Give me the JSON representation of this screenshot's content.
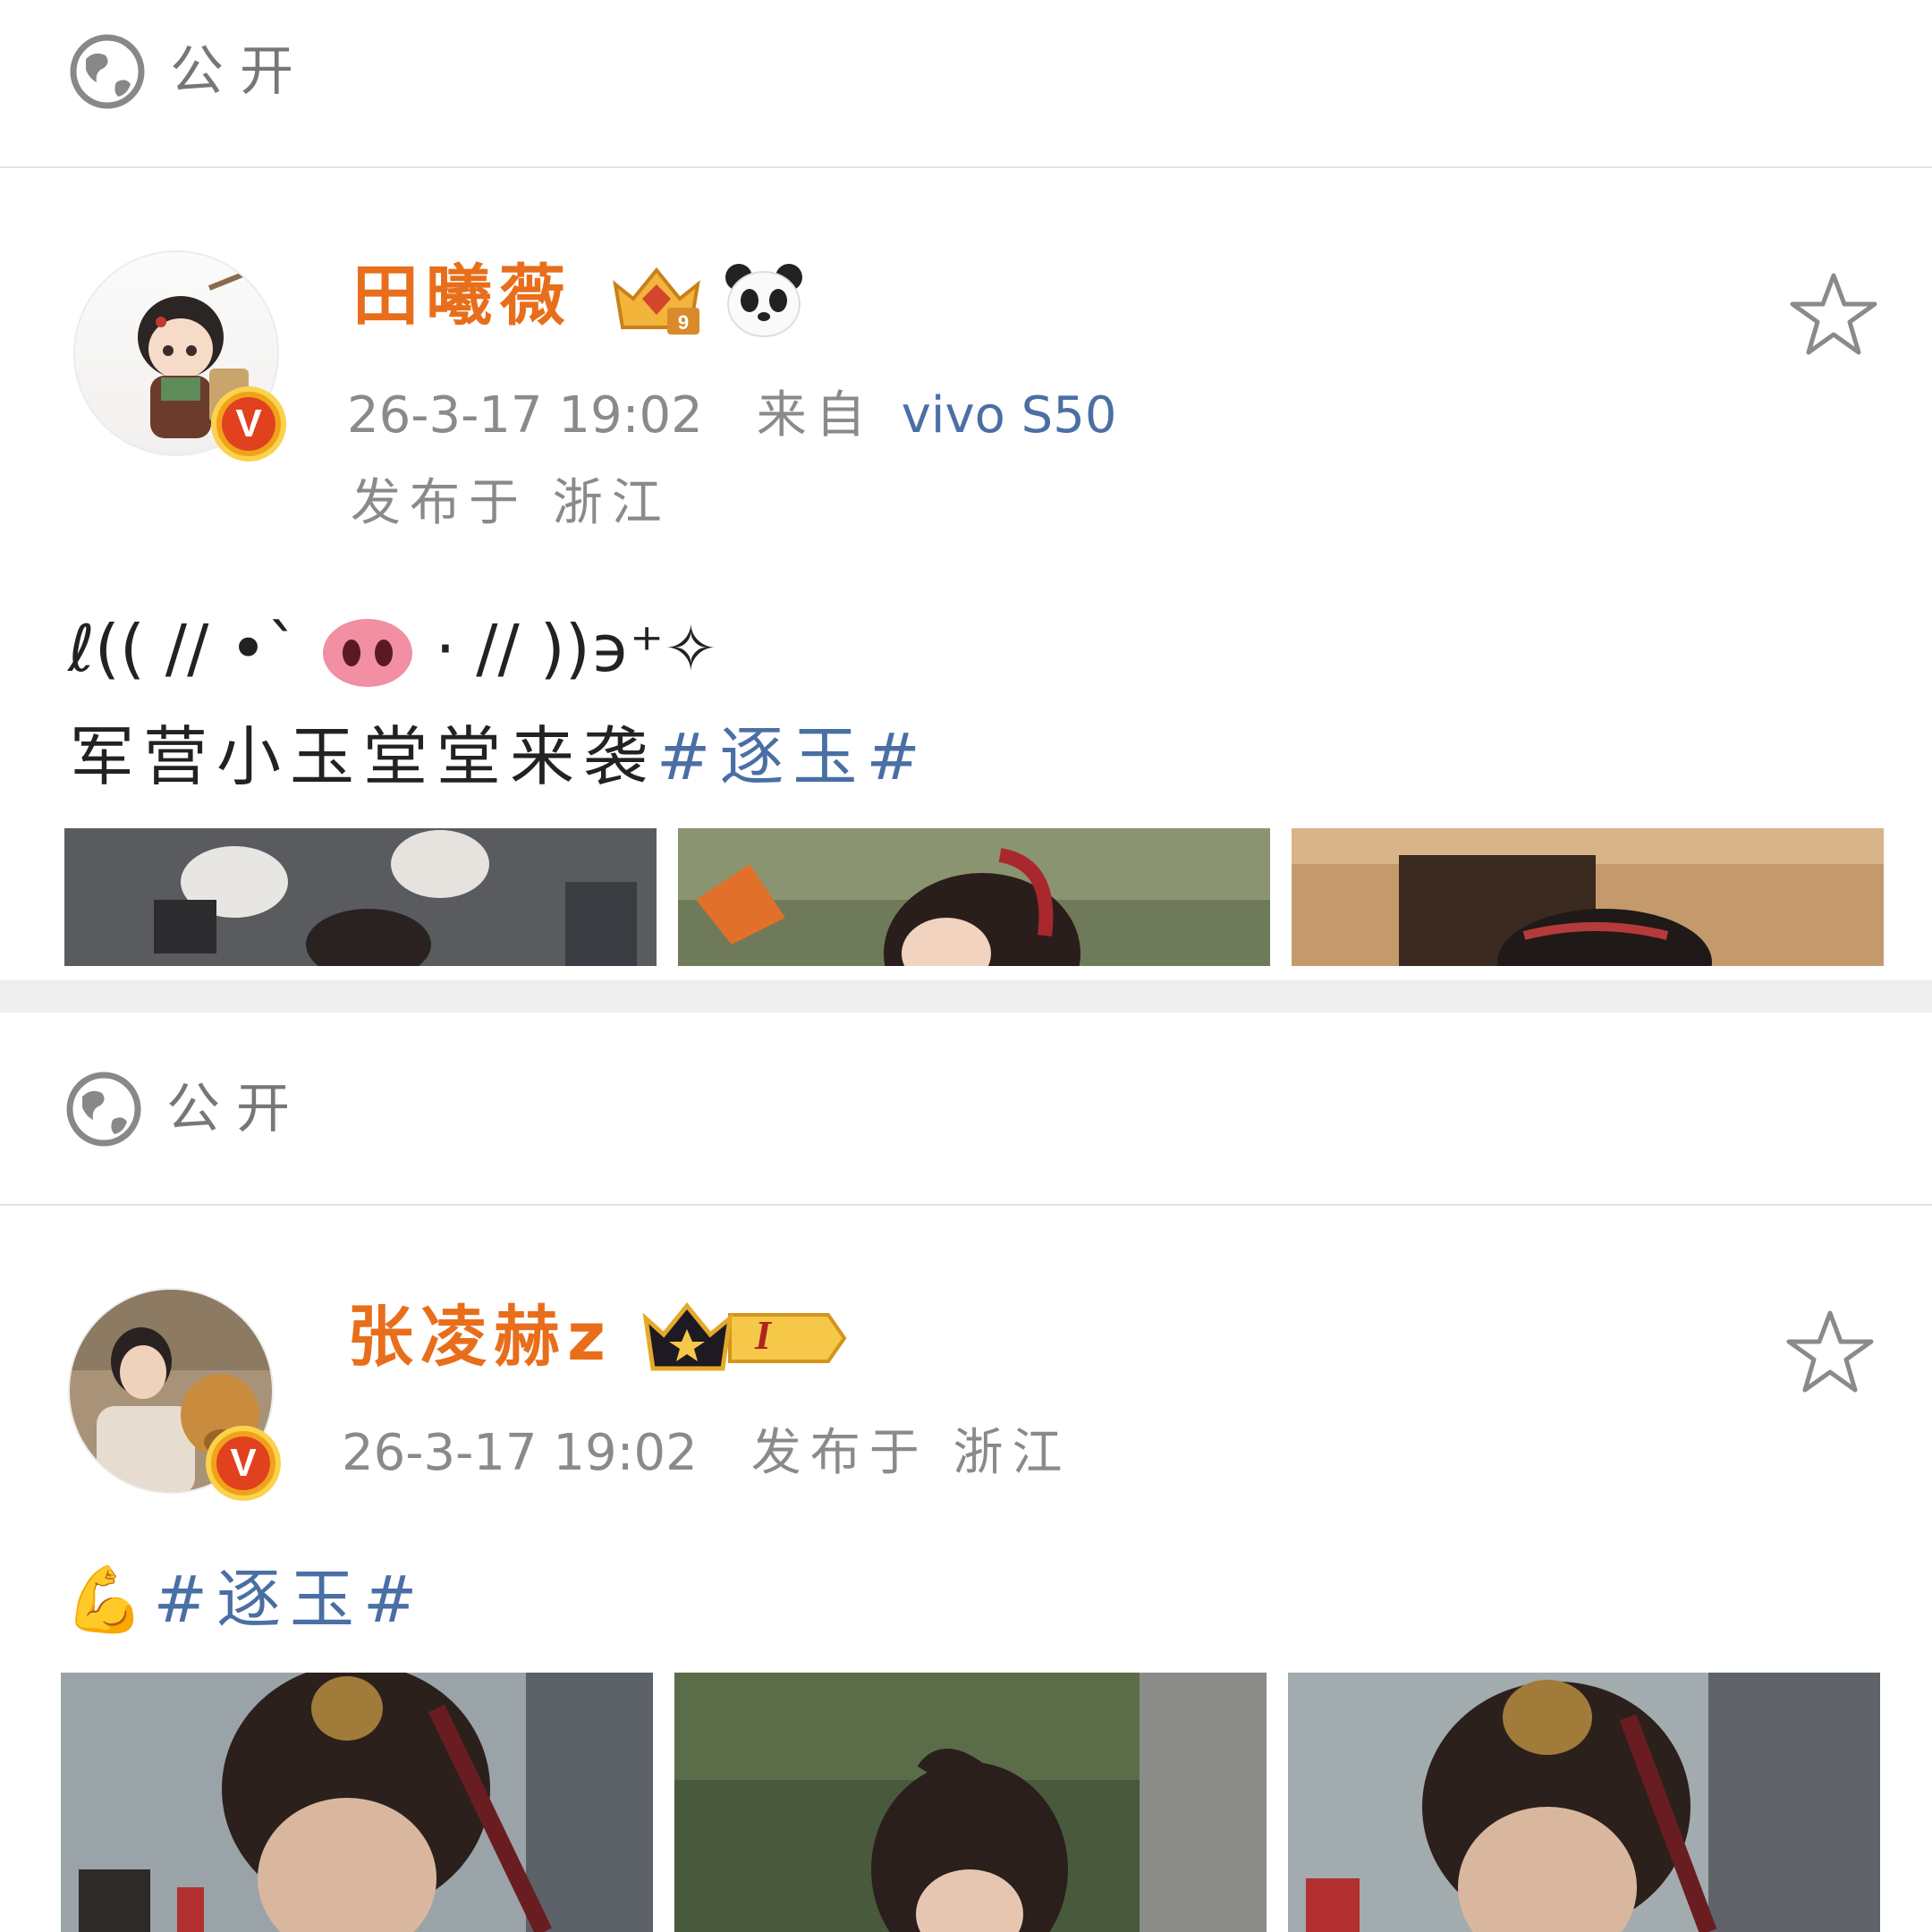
{
  "posts": [
    {
      "visibility": "公开",
      "username": "田曦薇",
      "timestamp": "26-3-17 19:02",
      "source": "来自",
      "device": "vivo S50",
      "location": "发布于 浙江",
      "kaomoji_left": "ℓ(( //  •`",
      "kaomoji_right": "·  // ))϶⁺✧",
      "text": "军营小玉堂堂来袭",
      "topic": "#逐玉#"
    },
    {
      "visibility": "公开",
      "username": "张凌赫z",
      "timestamp": "26-3-17 19:02",
      "location": "发布于 浙江",
      "emoji": "💪",
      "topic": "#逐玉#",
      "level_badge": "I"
    }
  ],
  "colors": {
    "username": "#e86e1c",
    "topic": "#4a6fa5",
    "meta": "#8a8a8a",
    "verified": "#e1411f"
  },
  "icons": [
    "globe-icon",
    "star-icon",
    "verified-v-icon",
    "crown-badge-icon",
    "panda-icon",
    "pig-nose-icon"
  ]
}
